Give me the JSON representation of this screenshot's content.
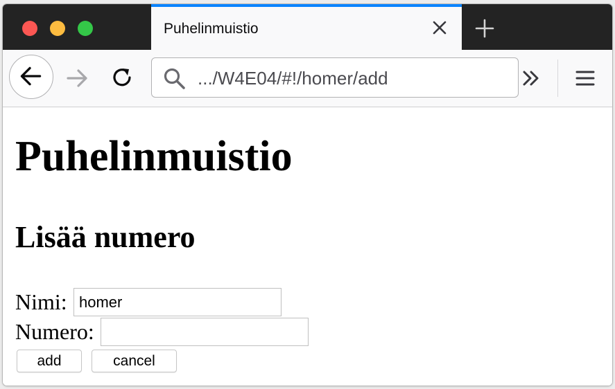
{
  "browser": {
    "tab": {
      "title": "Puhelinmuistio"
    },
    "url": ".../W4E04/#!/homer/add"
  },
  "page": {
    "heading": "Puhelinmuistio",
    "subheading": "Lisää numero",
    "form": {
      "name_label": "Nimi:",
      "name_value": "homer",
      "number_label": "Numero:",
      "number_value": "",
      "add_label": "add",
      "cancel_label": "cancel"
    }
  }
}
